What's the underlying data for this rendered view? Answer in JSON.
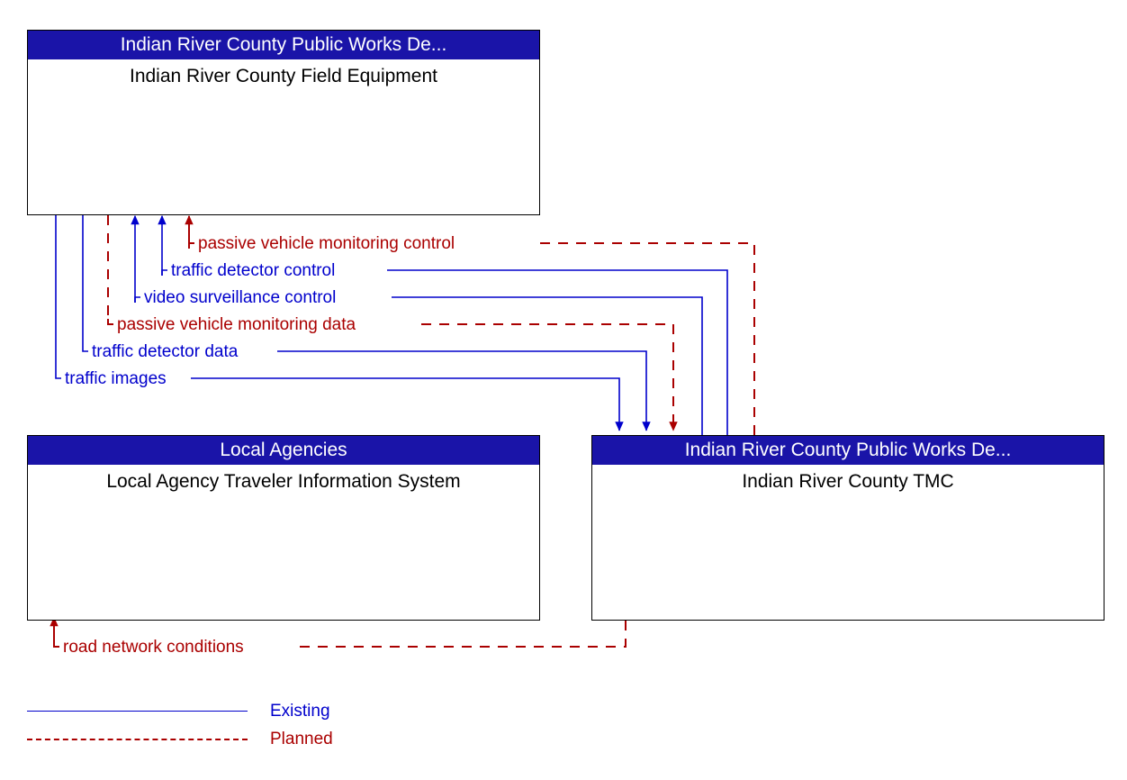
{
  "diagram": {
    "type": "architecture-interconnect",
    "nodes": [
      {
        "id": "field-equipment",
        "stakeholder": "Indian River County Public Works De...",
        "name": "Indian River County Field Equipment"
      },
      {
        "id": "local-agency-tis",
        "stakeholder": "Local Agencies",
        "name": "Local Agency Traveler Information System"
      },
      {
        "id": "irc-tmc",
        "stakeholder": "Indian River County Public Works De...",
        "name": "Indian River County TMC"
      }
    ],
    "flows": [
      {
        "id": "f1",
        "label": "passive vehicle monitoring control",
        "status": "Planned",
        "from": "irc-tmc",
        "to": "field-equipment"
      },
      {
        "id": "f2",
        "label": "traffic detector control",
        "status": "Existing",
        "from": "irc-tmc",
        "to": "field-equipment"
      },
      {
        "id": "f3",
        "label": "video surveillance control",
        "status": "Existing",
        "from": "irc-tmc",
        "to": "field-equipment"
      },
      {
        "id": "f4",
        "label": "passive vehicle monitoring data",
        "status": "Planned",
        "from": "field-equipment",
        "to": "irc-tmc"
      },
      {
        "id": "f5",
        "label": "traffic detector data",
        "status": "Existing",
        "from": "field-equipment",
        "to": "irc-tmc"
      },
      {
        "id": "f6",
        "label": "traffic images",
        "status": "Existing",
        "from": "field-equipment",
        "to": "irc-tmc"
      },
      {
        "id": "f7",
        "label": "road network conditions",
        "status": "Planned",
        "from": "irc-tmc",
        "to": "local-agency-tis"
      }
    ]
  },
  "legend": {
    "existing_label": "Existing",
    "planned_label": "Planned"
  },
  "colors": {
    "existing": "#0000cc",
    "planned": "#aa0000",
    "header_background": "#1a14a8",
    "header_text": "#ffffff",
    "node_border": "#000000",
    "node_background": "#ffffff",
    "title_text": "#000000"
  }
}
